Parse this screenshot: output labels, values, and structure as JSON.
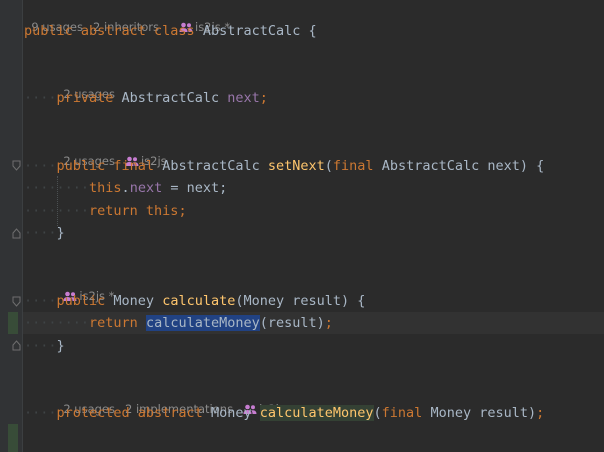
{
  "hints": {
    "class": {
      "usages": "9 usages",
      "inheritors": "2 inheritors",
      "author": "is2js *"
    },
    "next_field": {
      "usages": "2 usages"
    },
    "set_next": {
      "usages": "2 usages",
      "author": "is2js"
    },
    "calculate": {
      "author": "is2js *"
    },
    "calculate_money": {
      "usages": "2 usages",
      "implementations": "2 implementations",
      "author": "is2js"
    }
  },
  "code": {
    "l1": {
      "kw": "public abstract class ",
      "name": "AbstractCalc",
      "brace": " {"
    },
    "l2": {
      "kw": "private ",
      "type": "AbstractCalc ",
      "field": "next",
      "end": ";"
    },
    "l3": {
      "kw": "public final ",
      "type": "AbstractCalc ",
      "fn": "setNext",
      "p1": "(",
      "pkw": "final ",
      "ptype": "AbstractCalc next) {"
    },
    "l4": {
      "kw": "this",
      "dot": ".",
      "field": "next",
      "rest": " = next;"
    },
    "l5": {
      "kw": "return this",
      "end": ";"
    },
    "l6": {
      "brace": "}"
    },
    "l7": {
      "kw": "public ",
      "type": "Money ",
      "fn": "calculate",
      "rest": "(Money result) {"
    },
    "l8": {
      "kw": "return ",
      "call": "calculateMoney",
      "rest": "(result)",
      "end": ";"
    },
    "l9": {
      "brace": "}"
    },
    "l10": {
      "kw": "protected abstract ",
      "type": "Money ",
      "fn": "calculateMoney",
      "p1": "(",
      "pkw": "final ",
      "rest": "Money result)",
      "end": ";"
    }
  },
  "colors": {
    "background": "#2b2b2b",
    "keyword": "#cc7832",
    "method": "#ffc66d",
    "field": "#9876aa",
    "selection": "#214283",
    "hint": "#8c8c8c"
  }
}
